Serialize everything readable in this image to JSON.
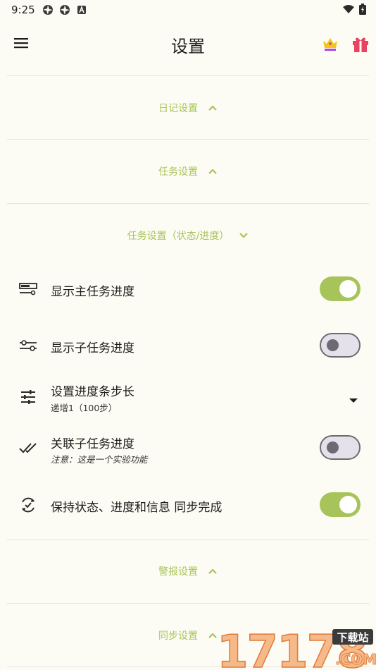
{
  "status_bar": {
    "time": "9:25"
  },
  "app_bar": {
    "title": "设置",
    "menu_icon": "hamburger-menu-icon",
    "crown_icon": "crown-icon",
    "gift_icon": "gift-icon"
  },
  "sections": {
    "diary": {
      "label": "日记设置",
      "expanded": false
    },
    "task": {
      "label": "任务设置",
      "expanded": false
    },
    "task_progress": {
      "label": "任务设置（状态/进度）",
      "expanded": true
    },
    "alarm": {
      "label": "警报设置",
      "expanded": false
    },
    "sync": {
      "label": "同步设置",
      "expanded": false
    }
  },
  "settings": {
    "show_main_progress": {
      "label": "显示主任务进度",
      "on": true,
      "icon": "progress-bar-icon"
    },
    "show_sub_progress": {
      "label": "显示子任务进度",
      "on": false,
      "icon": "sliders-icon"
    },
    "progress_step": {
      "label": "设置进度条步长",
      "value": "递增1（100步）",
      "icon": "tune-icon"
    },
    "link_sub_progress": {
      "label": "关联子任务进度",
      "note": "注意：这是一个实验功能",
      "on": false,
      "icon": "double-check-icon"
    },
    "keep_sync": {
      "label": "保持状态、进度和信息 同步完成",
      "on": true,
      "icon": "sync-icon"
    }
  },
  "watermark": {
    "text": "17178",
    "badge": "下载站",
    "suffix": ".COM"
  },
  "colors": {
    "accent": "#a7c45a",
    "background": "#fdfcf4",
    "toggle_off": "#e5e1ea"
  }
}
